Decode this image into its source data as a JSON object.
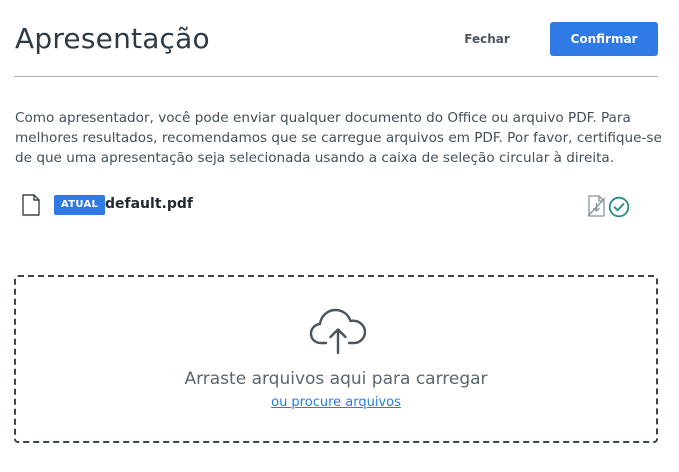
{
  "dialog": {
    "title": "Apresentação",
    "close_label": "Fechar",
    "confirm_label": "Confirmar"
  },
  "description": "Como apresentador, você pode enviar qualquer documento do Office ou arquivo PDF. Para melhores resultados, recomendamos que se carregue arquivos em PDF. Por favor, certifique-se de que uma apresentação seja selecionada usando a caixa de seleção circular à direita.",
  "files": [
    {
      "badge": "ATUAL",
      "name": "default.pdf",
      "icons": [
        "file-icon",
        "download-disabled-icon",
        "check-circle-icon"
      ]
    }
  ],
  "dropzone": {
    "icon": "cloud-upload-icon",
    "text": "Arraste arquivos aqui para carregar",
    "browse_link": "ou procure arquivos"
  },
  "colors": {
    "accent": "#2f7ae5",
    "check": "#2e8a8a",
    "text": "#2d3b45"
  }
}
